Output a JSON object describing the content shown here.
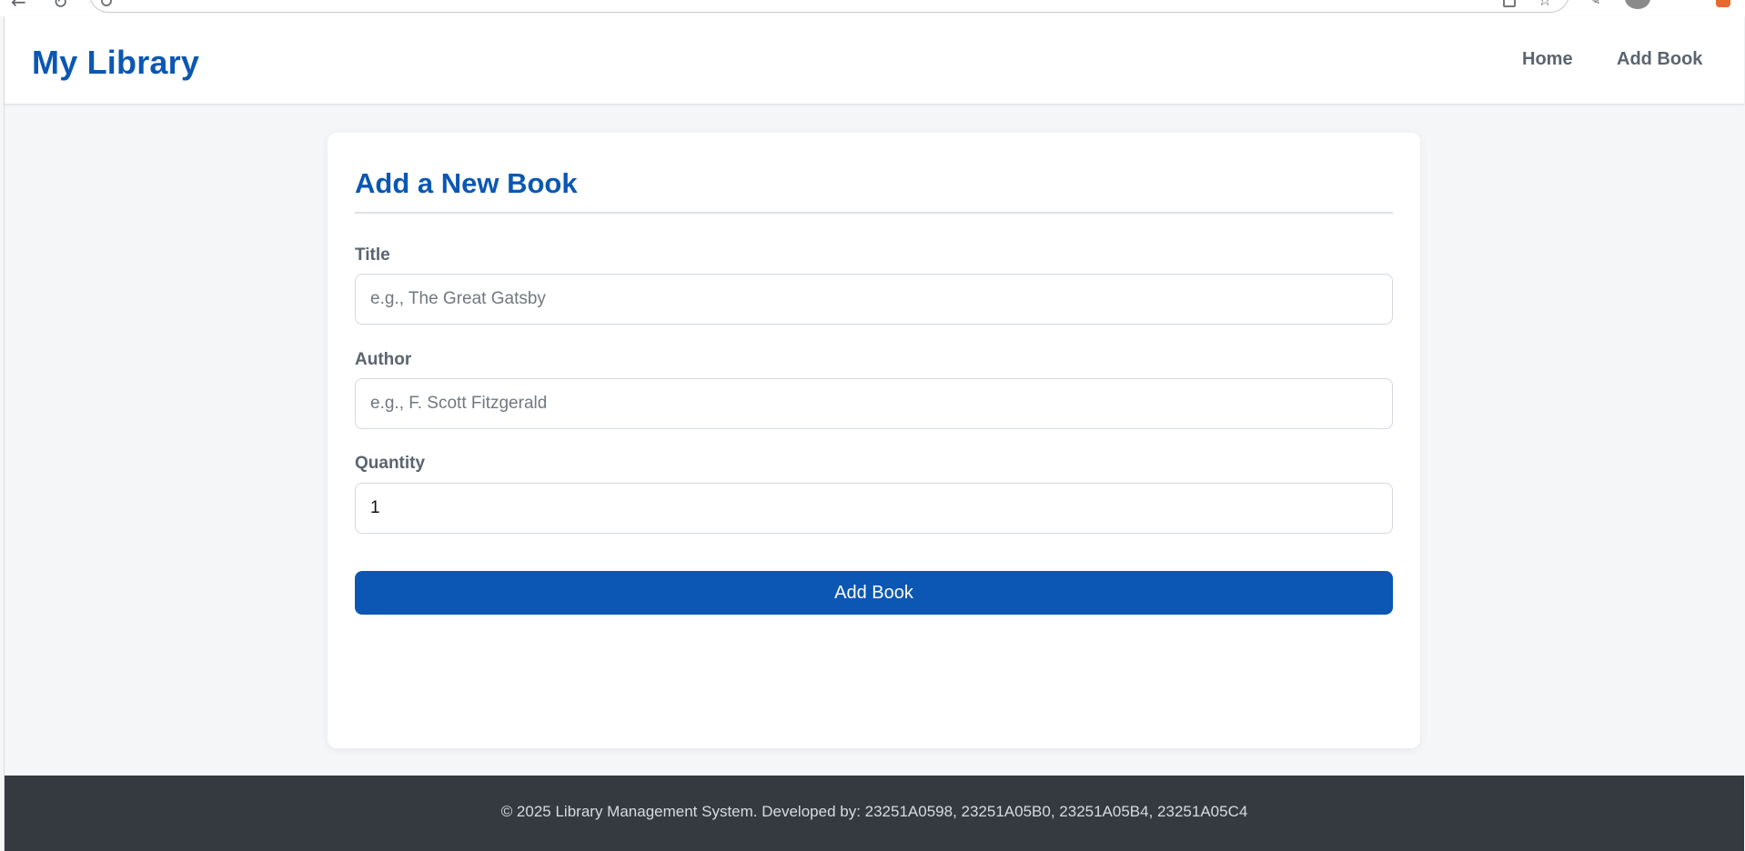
{
  "navbar": {
    "brand": "My Library",
    "links": [
      "Home",
      "Add Book"
    ]
  },
  "form": {
    "heading": "Add a New Book",
    "fields": [
      {
        "label": "Title",
        "placeholder": "e.g., The Great Gatsby",
        "value": ""
      },
      {
        "label": "Author",
        "placeholder": "e.g., F. Scott Fitzgerald",
        "value": ""
      },
      {
        "label": "Quantity",
        "placeholder": "",
        "value": "1"
      }
    ],
    "submit_label": "Add Book"
  },
  "footer": {
    "text": "© 2025 Library Management System. Developed by: 23251A0598, 23251A05B0, 23251A05B4, 23251A05C4"
  },
  "colors": {
    "brand": "#0b57b3",
    "footer_bg": "#343a40",
    "page_bg": "#f5f6f8"
  },
  "icons": [
    "back-arrow-icon",
    "reload-icon",
    "site-info-icon",
    "tab-icon",
    "bookmark-star-icon",
    "extensions-icon",
    "profile-avatar-icon",
    "extension-badge-icon"
  ]
}
